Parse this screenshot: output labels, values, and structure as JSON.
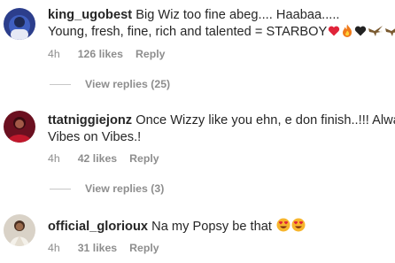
{
  "comments": [
    {
      "username": "king_ugobest",
      "text_line1": "Big Wiz too fine abeg.... Haabaa.....",
      "text_line2": "Young, fresh, fine, rich and talented = STARBOY",
      "emojis": [
        "red-heart",
        "fire",
        "black-heart",
        "eagle",
        "eagle"
      ],
      "time": "4h",
      "likes": "126 likes",
      "reply_label": "Reply",
      "view_replies": "View replies (25)"
    },
    {
      "username": "ttatniggiejonz",
      "text_line1": "Once Wizzy like you ehn, e don finish..!!! Always",
      "text_line2": "Vibes on Vibes.!",
      "time": "4h",
      "likes": "42 likes",
      "reply_label": "Reply",
      "view_replies": "View replies (3)"
    },
    {
      "username": "official_glorioux",
      "text_line1": "Na my Popsy be that",
      "emojis": [
        "heart-eyes",
        "heart-eyes"
      ],
      "time": "4h",
      "likes": "31 likes",
      "reply_label": "Reply"
    }
  ],
  "colors": {
    "text": "#262626",
    "muted": "#8e8e8e",
    "divider": "#c7c7c7"
  }
}
